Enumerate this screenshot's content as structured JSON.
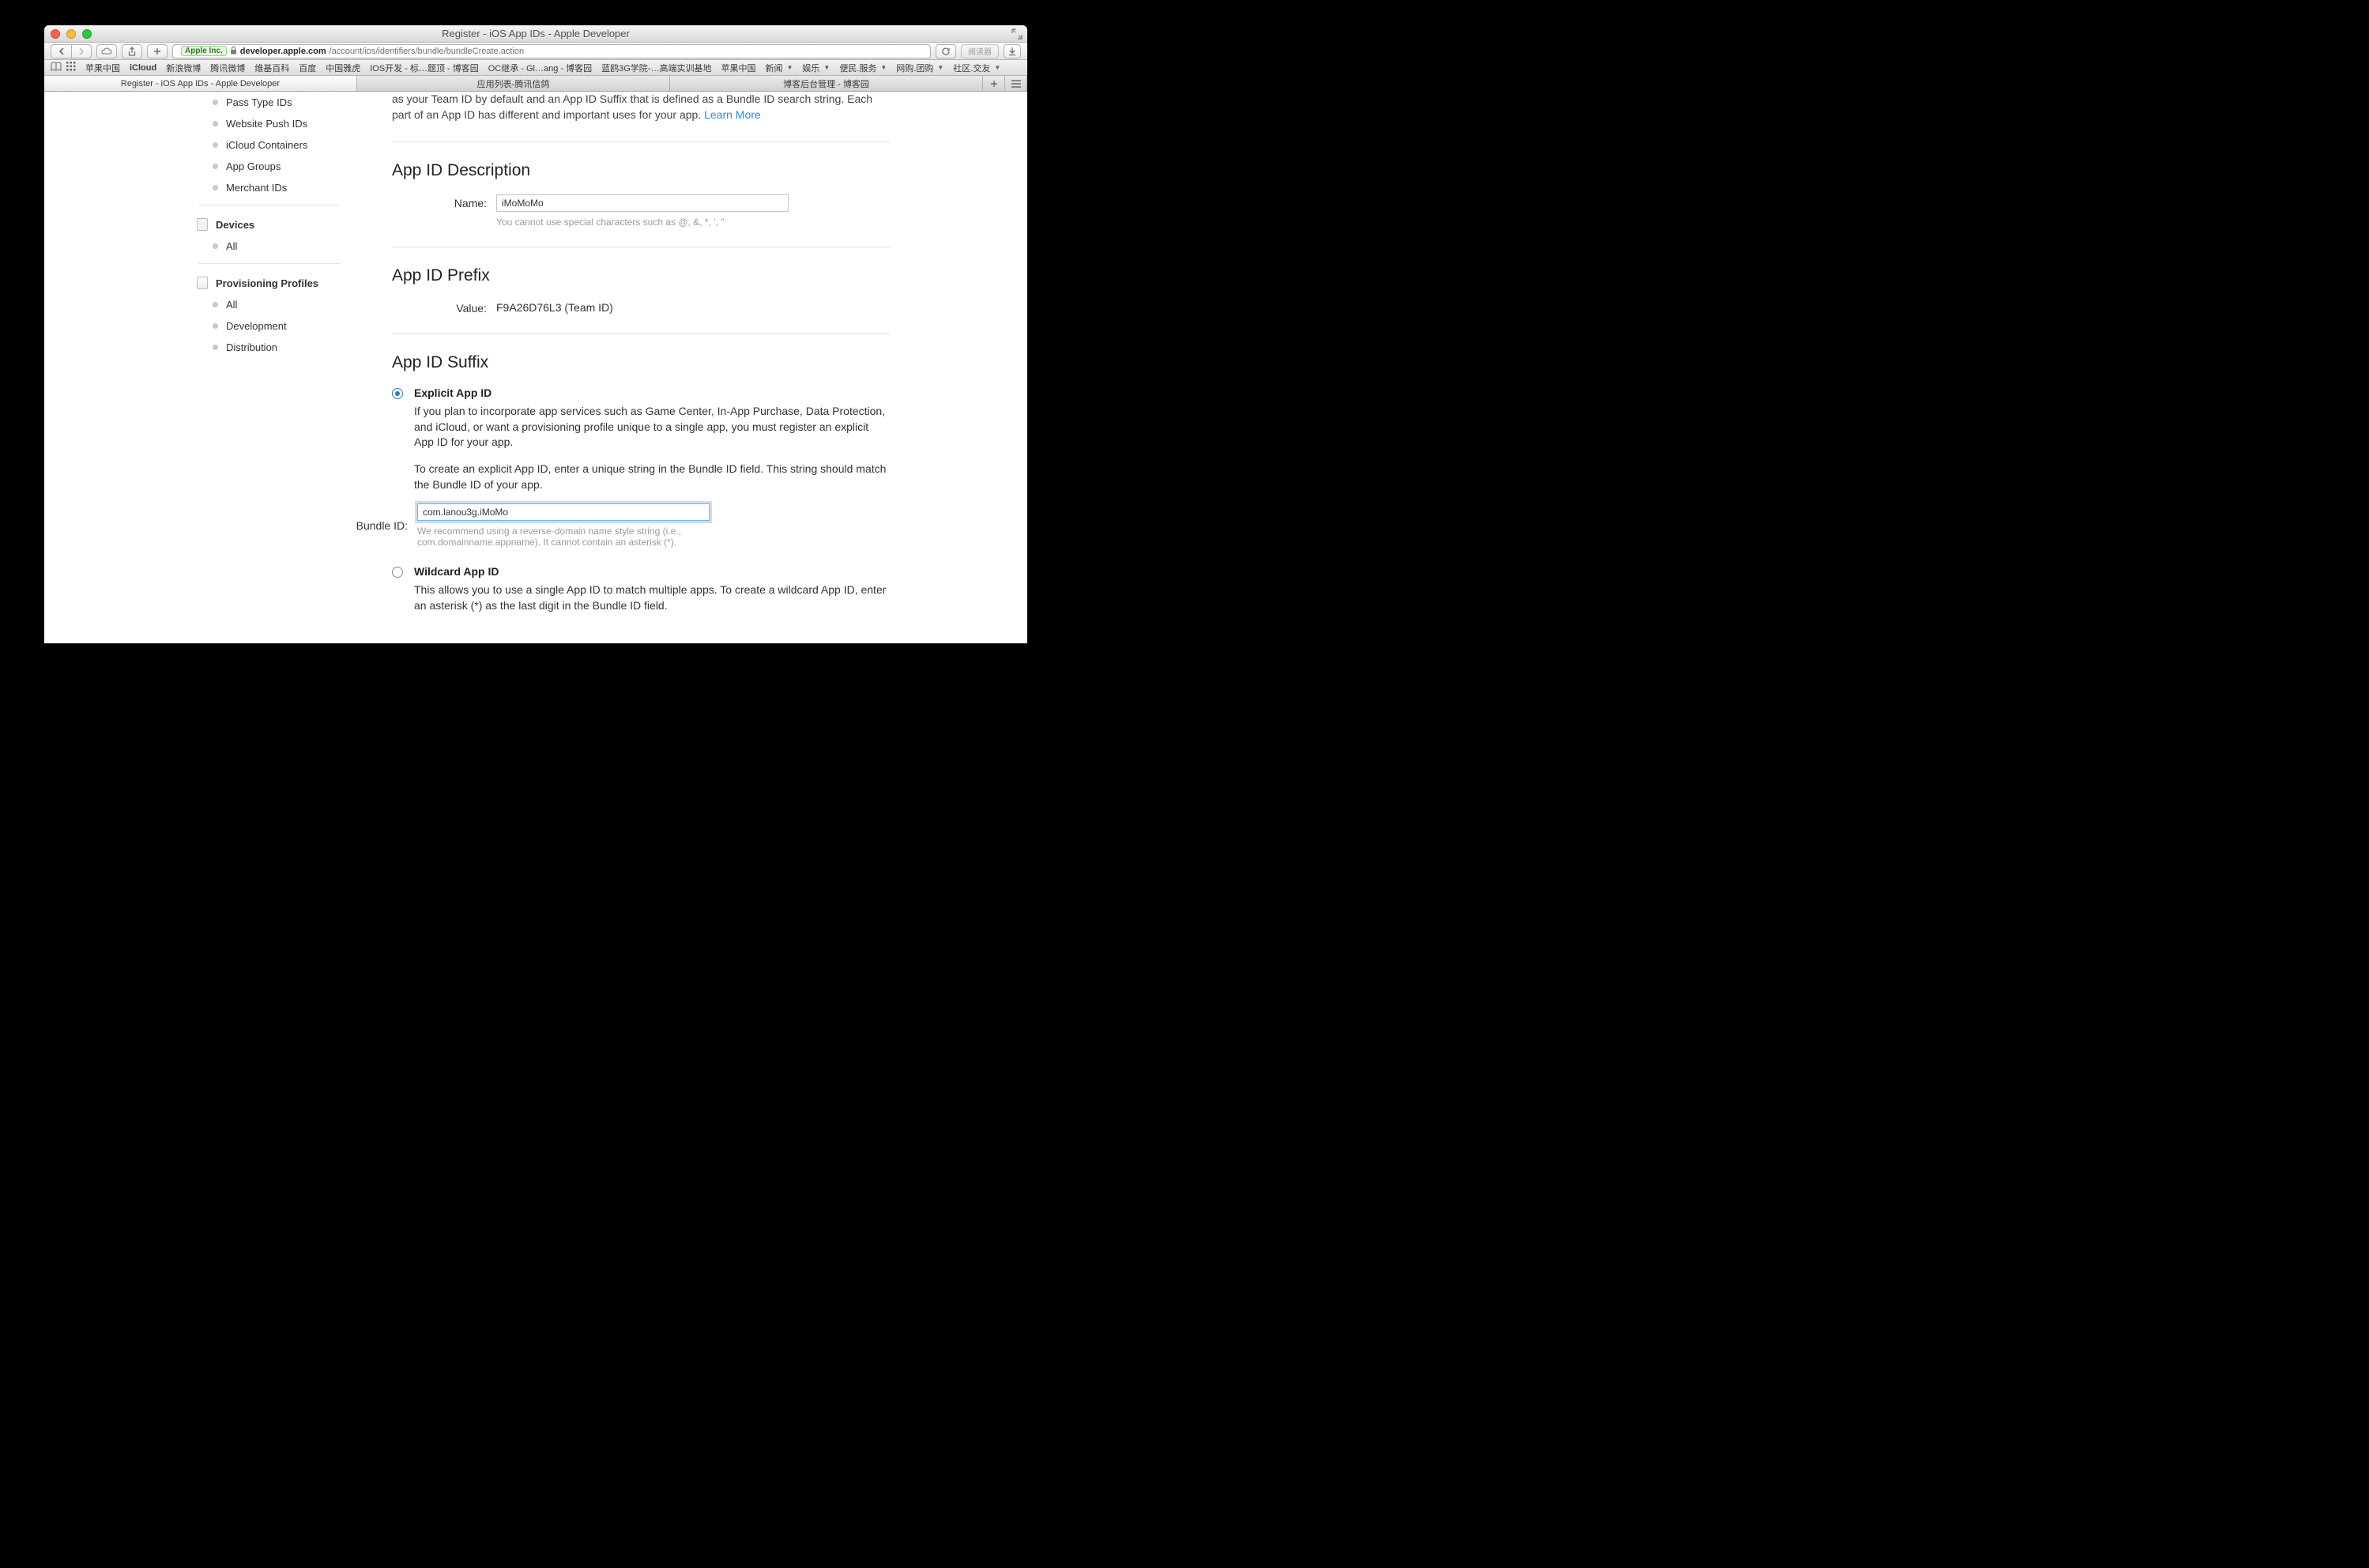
{
  "window": {
    "title": "Register - iOS App IDs - Apple Developer"
  },
  "url": {
    "certifier": "Apple Inc.",
    "host": "developer.apple.com",
    "path": "/account/ios/identifiers/bundle/bundleCreate.action"
  },
  "reader_label": "阅读器",
  "bookmarks": [
    {
      "label": "苹果中国",
      "dd": false,
      "bold": false
    },
    {
      "label": "iCloud",
      "dd": false,
      "bold": true
    },
    {
      "label": "新浪微博",
      "dd": false,
      "bold": false
    },
    {
      "label": "腾讯微博",
      "dd": false,
      "bold": false
    },
    {
      "label": "维基百科",
      "dd": false,
      "bold": false
    },
    {
      "label": "百度",
      "dd": false,
      "bold": false
    },
    {
      "label": "中国雅虎",
      "dd": false,
      "bold": false
    },
    {
      "label": "IOS开发 - 标…题顶 - 博客园",
      "dd": false,
      "bold": false
    },
    {
      "label": "OC继承 - Gl…ang - 博客园",
      "dd": false,
      "bold": false
    },
    {
      "label": "蓝鸥3G学院-…高端实训基地",
      "dd": false,
      "bold": false
    },
    {
      "label": "苹果中国",
      "dd": false,
      "bold": false
    },
    {
      "label": "新闻",
      "dd": true,
      "bold": false
    },
    {
      "label": "娱乐",
      "dd": true,
      "bold": false
    },
    {
      "label": "便民.服务",
      "dd": true,
      "bold": false
    },
    {
      "label": "网购.团购",
      "dd": true,
      "bold": false
    },
    {
      "label": "社区.交友",
      "dd": true,
      "bold": false
    }
  ],
  "tabs": [
    {
      "label": "Register - iOS App IDs - Apple Developer",
      "active": true
    },
    {
      "label": "应用列表-腾讯信鸽",
      "active": false
    },
    {
      "label": "博客后台管理 - 博客园",
      "active": false
    }
  ],
  "sidebar": {
    "items_top": [
      {
        "label": "Pass Type IDs"
      },
      {
        "label": "Website Push IDs"
      },
      {
        "label": "iCloud Containers"
      },
      {
        "label": "App Groups"
      },
      {
        "label": "Merchant IDs"
      }
    ],
    "devices_h": "Devices",
    "devices_items": [
      {
        "label": "All"
      }
    ],
    "prov_h": "Provisioning Profiles",
    "prov_items": [
      {
        "label": "All"
      },
      {
        "label": "Development"
      },
      {
        "label": "Distribution"
      }
    ]
  },
  "intro": {
    "line": "as your Team ID by default and an App ID Suffix that is defined as a Bundle ID search string. Each part of an App ID has different and important uses for your app. ",
    "learn_more": "Learn More"
  },
  "desc_section": {
    "heading": "App ID Description",
    "name_label": "Name:",
    "name_value": "iMoMoMo",
    "name_hint": "You cannot use special characters such as @, &, *, ', \""
  },
  "prefix_section": {
    "heading": "App ID Prefix",
    "value_label": "Value:",
    "value": "F9A26D76L3 (Team ID)"
  },
  "suffix_section": {
    "heading": "App ID Suffix",
    "explicit": {
      "title": "Explicit App ID",
      "p1": "If you plan to incorporate app services such as Game Center, In-App Purchase, Data Protection, and iCloud, or want a provisioning profile unique to a single app, you must register an explicit App ID for your app.",
      "p2": "To create an explicit App ID, enter a unique string in the Bundle ID field. This string should match the Bundle ID of your app.",
      "bundle_label": "Bundle ID:",
      "bundle_value": "com.lanou3g.iMoMo",
      "bundle_hint": "We recommend using a reverse-domain name style string (i.e., com.domainname.appname). It cannot contain an asterisk (*)."
    },
    "wildcard": {
      "title": "Wildcard App ID",
      "p1": "This allows you to use a single App ID to match multiple apps. To create a wildcard App ID, enter an asterisk (*) as the last digit in the Bundle ID field."
    }
  }
}
